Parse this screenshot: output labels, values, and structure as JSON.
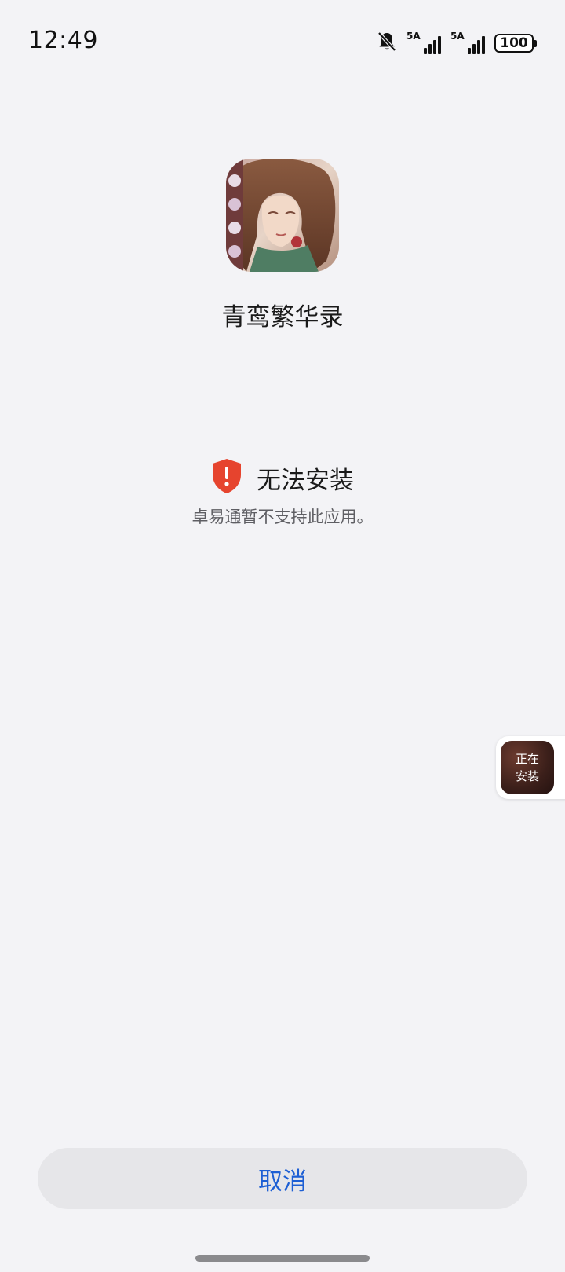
{
  "status_bar": {
    "time": "12:49",
    "sim1_network": "5A",
    "sim2_network": "5A",
    "battery_level": "100",
    "icons": [
      "bell-muted-icon",
      "signal-icon",
      "signal-icon",
      "battery-icon"
    ]
  },
  "app": {
    "name": "青鸾繁华录",
    "icon": "app-character-portrait-icon"
  },
  "install_status": {
    "title": "无法安装",
    "description": "卓易通暂不支持此应用。",
    "icon": "shield-warning-icon",
    "icon_color": "#e6442e"
  },
  "floating_widget": {
    "label": "正在\n安装"
  },
  "footer": {
    "cancel_label": "取消",
    "cancel_color": "#1d5fd4"
  }
}
